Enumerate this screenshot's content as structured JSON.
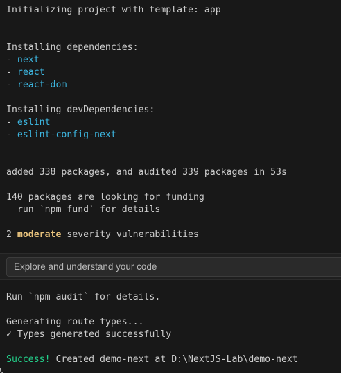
{
  "terminal": {
    "init": "Initializing project with template: app",
    "deps_heading": "Installing dependencies:",
    "deps": [
      "next",
      "react",
      "react-dom"
    ],
    "dev_deps_heading": "Installing devDependencies:",
    "dev_deps": [
      "eslint",
      "eslint-config-next"
    ],
    "bullet": "- ",
    "added": "added 338 packages, and audited 339 packages in 53s",
    "funding_1": "140 packages are looking for funding",
    "funding_2": "  run `npm fund` for details",
    "vuln_count": "2 ",
    "vuln_level": "moderate",
    "vuln_rest": " severity vulnerabilities",
    "audit": "Run `npm audit` for details.",
    "route_types": "Generating route types...",
    "types_ok": "✓ Types generated successfully",
    "success_label": "Success!",
    "success_rest": " Created demo-next at D:\\NextJS-Lab\\demo-next"
  },
  "overlay": {
    "placeholder": "Explore and understand your code"
  },
  "colors": {
    "background": "#181818",
    "text": "#cccccc",
    "package_name": "#3db6e0",
    "warning": "#e5c07b",
    "success": "#23d18b"
  }
}
